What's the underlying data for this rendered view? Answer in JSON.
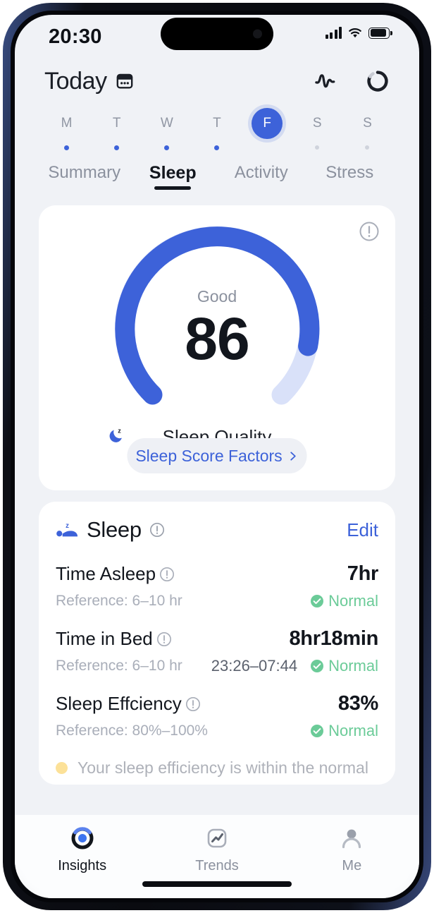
{
  "status_bar": {
    "time": "20:30",
    "signal_icon": "cellular-bars-icon",
    "wifi_icon": "wifi-icon",
    "battery_icon": "battery-icon"
  },
  "header": {
    "title": "Today",
    "calendar_icon": "calendar-icon",
    "actions": [
      {
        "name": "heartbeat-icon",
        "label": "Vitals"
      },
      {
        "name": "sync-ring-icon",
        "label": "Sync"
      }
    ]
  },
  "week_strip": {
    "days": [
      {
        "letter": "M",
        "selected": false,
        "has_data": true
      },
      {
        "letter": "T",
        "selected": false,
        "has_data": true
      },
      {
        "letter": "W",
        "selected": false,
        "has_data": true
      },
      {
        "letter": "T",
        "selected": false,
        "has_data": true
      },
      {
        "letter": "F",
        "selected": true,
        "has_data": true
      },
      {
        "letter": "S",
        "selected": false,
        "has_data": false
      },
      {
        "letter": "S",
        "selected": false,
        "has_data": false
      }
    ]
  },
  "tabs": [
    {
      "label": "Summary",
      "active": false
    },
    {
      "label": "Sleep",
      "active": true
    },
    {
      "label": "Activity",
      "active": false
    },
    {
      "label": "Stress",
      "active": false
    }
  ],
  "score_card": {
    "info_icon": "info-circle-icon",
    "rating": "Good",
    "score": "86",
    "caption": "Sleep Quality",
    "caption_icon": "moon-zzz-icon",
    "factors_button": "Sleep Score Factors",
    "chevron_icon": "chevron-right-icon",
    "arc_value": 86,
    "arc_max": 100,
    "arc_color": "#3d62d9",
    "arc_track_color": "#d9e1f9"
  },
  "detail_card": {
    "icon": "bed-sleep-icon",
    "title": "Sleep",
    "info_icon": "info-circle-icon",
    "edit_label": "Edit",
    "metrics": [
      {
        "name": "Time Asleep",
        "info_icon": "info-circle-icon",
        "value": "7hr",
        "reference": "Reference: 6–10 hr",
        "range": "",
        "status": "Normal",
        "status_icon": "check-circle-icon",
        "status_color": "#6bcb98"
      },
      {
        "name": "Time in Bed",
        "info_icon": "info-circle-icon",
        "value": "8hr18min",
        "reference": "Reference: 6–10 hr",
        "range": "23:26–07:44",
        "status": "Normal",
        "status_icon": "check-circle-icon",
        "status_color": "#6bcb98"
      },
      {
        "name": "Sleep Effciency",
        "info_icon": "info-circle-icon",
        "value": "83%",
        "reference": "Reference: 80%–100%",
        "range": "",
        "status": "Normal",
        "status_icon": "check-circle-icon",
        "status_color": "#6bcb98"
      }
    ],
    "insight": {
      "bullet_color": "#fbc944",
      "text": "Your sleep efficiency is within the normal"
    }
  },
  "bottom_nav": [
    {
      "label": "Insights",
      "icon": "insights-ring-icon",
      "active": true
    },
    {
      "label": "Trends",
      "icon": "trends-chart-icon",
      "active": false
    },
    {
      "label": "Me",
      "icon": "person-icon",
      "active": false
    }
  ]
}
